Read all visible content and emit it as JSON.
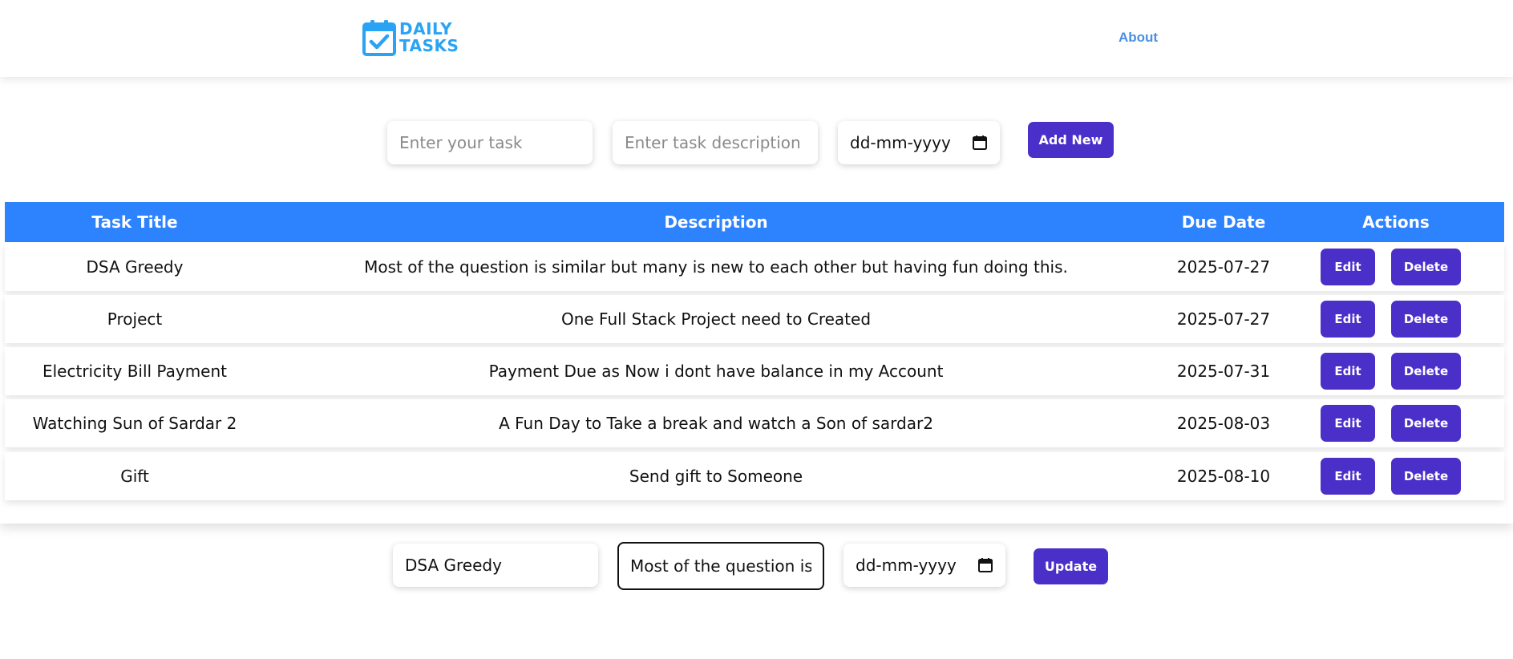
{
  "brand": {
    "line1": "DAILY",
    "line2": "TASKS",
    "color": "#2aa3f5"
  },
  "nav": {
    "about": "About"
  },
  "add_form": {
    "task_placeholder": "Enter your task",
    "description_placeholder": "Enter task description",
    "date_placeholder": "dd-mm-yyyy",
    "add_button": "Add New"
  },
  "table": {
    "headers": [
      "Task Title",
      "Description",
      "Due Date",
      "Actions"
    ],
    "header_color": "#2d82fe",
    "rows": [
      {
        "title": "DSA Greedy",
        "description": "Most of the question is similar but many is new to each other but having fun doing this.",
        "due": "2025-07-27",
        "edit": "Edit",
        "delete": "Delete"
      },
      {
        "title": "Project",
        "description": "One Full Stack Project need to Created",
        "due": "2025-07-27",
        "edit": "Edit",
        "delete": "Delete"
      },
      {
        "title": "Electricity Bill Payment",
        "description": "Payment Due as Now i dont have balance in my Account",
        "due": "2025-07-31",
        "edit": "Edit",
        "delete": "Delete"
      },
      {
        "title": "Watching Sun of Sardar 2",
        "description": "A Fun Day to Take a break and watch a Son of sardar2",
        "due": "2025-08-03",
        "edit": "Edit",
        "delete": "Delete"
      },
      {
        "title": "Gift",
        "description": "Send gift to Someone",
        "due": "2025-08-10",
        "edit": "Edit",
        "delete": "Delete"
      }
    ]
  },
  "edit_form": {
    "task_value": "DSA Greedy",
    "description_value": "Most of the question is sir",
    "date_placeholder": "dd-mm-yyyy",
    "update_button": "Update"
  },
  "button_color": "#4b2fc9"
}
